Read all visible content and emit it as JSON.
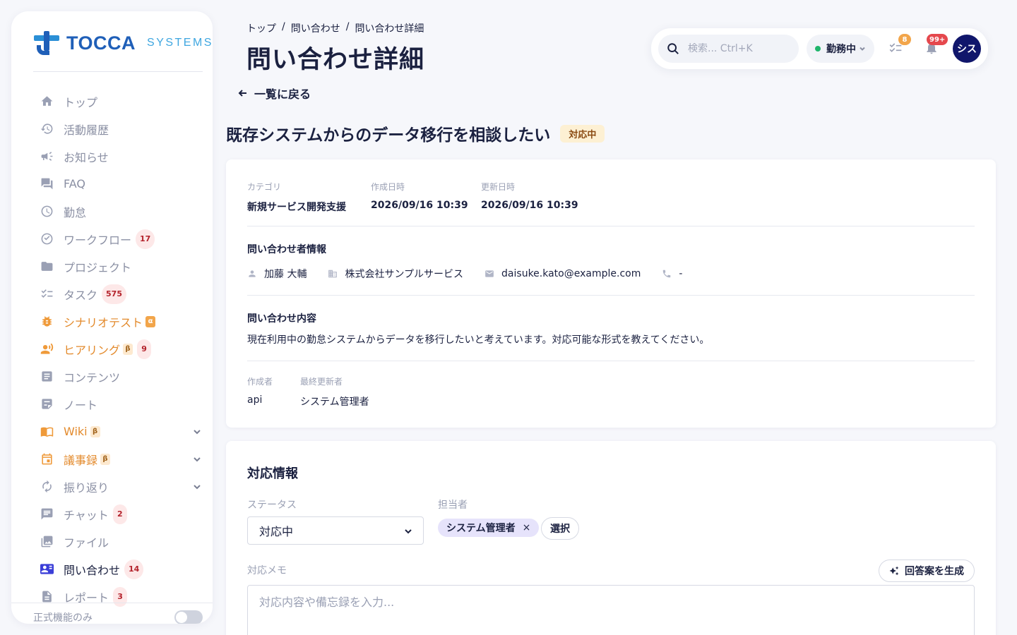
{
  "brand": {
    "name": "TOCCA",
    "sub": "SYSTEMS"
  },
  "sidebar": {
    "items": [
      {
        "label": "トップ",
        "icon": "home-icon"
      },
      {
        "label": "活動履歴",
        "icon": "history-icon"
      },
      {
        "label": "お知らせ",
        "icon": "megaphone-icon"
      },
      {
        "label": "FAQ",
        "icon": "forum-icon"
      },
      {
        "label": "勤怠",
        "icon": "clock-icon"
      },
      {
        "label": "ワークフロー",
        "icon": "check-circle-icon",
        "badge": "17"
      },
      {
        "label": "プロジェクト",
        "icon": "folder-icon"
      },
      {
        "label": "タスク",
        "icon": "checklist-icon",
        "badge": "575"
      },
      {
        "label": "シナリオテスト",
        "icon": "bug-icon",
        "tag": "α"
      },
      {
        "label": "ヒアリング",
        "icon": "interview-icon",
        "tag": "β",
        "badge": "9"
      },
      {
        "label": "コンテンツ",
        "icon": "article-icon"
      },
      {
        "label": "ノート",
        "icon": "note-icon"
      },
      {
        "label": "Wiki",
        "icon": "book-icon",
        "tag": "β"
      },
      {
        "label": "議事録",
        "icon": "calendar-icon",
        "tag": "β"
      },
      {
        "label": "振り返り",
        "icon": "refresh-icon"
      },
      {
        "label": "チャット",
        "icon": "chat-icon",
        "badge": "2"
      },
      {
        "label": "ファイル",
        "icon": "image-icon"
      },
      {
        "label": "問い合わせ",
        "icon": "contact-card-icon",
        "badge": "14"
      },
      {
        "label": "レポート",
        "icon": "report-icon",
        "badge": "3"
      }
    ],
    "footer_label": "正式機能のみ"
  },
  "breadcrumb": {
    "home": "トップ",
    "list": "問い合わせ",
    "current": "問い合わせ詳細",
    "sep": "/"
  },
  "page_title": "問い合わせ詳細",
  "back_label": "一覧に戻る",
  "topbar": {
    "search_placeholder": "検索... Ctrl+K",
    "work_status": "勤務中",
    "task_badge": "8",
    "notif_badge": "99+",
    "avatar_label": "シス",
    "colors": {
      "task_badge": "#f2a54a",
      "notif_badge": "#e5484d",
      "avatar": "#10166b"
    }
  },
  "inquiry": {
    "title": "既存システムからのデータ移行を相談したい",
    "status": "対応中",
    "meta": {
      "category_label": "カテゴリ",
      "category": "新規サービス開発支援",
      "created_label": "作成日時",
      "created": "2026/09/16 10:39",
      "updated_label": "更新日時",
      "updated": "2026/09/16 10:39"
    },
    "contact_heading": "問い合わせ者情報",
    "contact": {
      "name": "加藤 大輔",
      "company": "株式会社サンプルサービス",
      "email": "daisuke.kato@example.com",
      "phone": "-"
    },
    "content_heading": "問い合わせ内容",
    "content": "現在利用中の勤怠システムからデータを移行したいと考えています。対応可能な形式を教えてください。",
    "author_label": "作成者",
    "author": "api",
    "last_editor_label": "最終更新者",
    "last_editor": "システム管理者"
  },
  "response": {
    "heading": "対応情報",
    "status_label": "ステータス",
    "status_value": "対応中",
    "assignee_label": "担当者",
    "assignee": "システム管理者",
    "select_label": "選択",
    "memo_label": "対応メモ",
    "generate_label": "回答案を生成",
    "memo_placeholder": "対応内容や備忘録を入力..."
  }
}
